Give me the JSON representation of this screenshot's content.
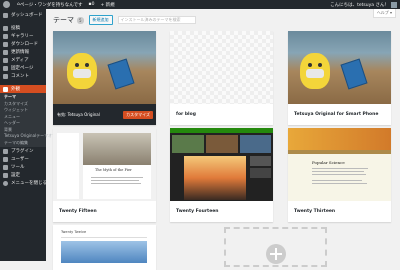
{
  "adminbar": {
    "site_name": "ページ・ワンダを持ちなんです",
    "comments": "0",
    "new_label": "+ 新規",
    "greeting": "こんにちは、tetsuya さん！"
  },
  "sidebar": {
    "items": [
      {
        "label": "ダッシュボード",
        "icon": "dashboard-icon"
      },
      {
        "label": "投稿",
        "icon": "pin-icon"
      },
      {
        "label": "ギャラリー",
        "icon": "gallery-icon"
      },
      {
        "label": "ダウンロード",
        "icon": "download-icon"
      },
      {
        "label": "更新情報",
        "icon": "news-icon"
      },
      {
        "label": "メディア",
        "icon": "media-icon"
      },
      {
        "label": "固定ページ",
        "icon": "page-icon"
      },
      {
        "label": "コメント",
        "icon": "comment-icon"
      },
      {
        "label": "外観",
        "icon": "appearance-icon"
      },
      {
        "label": "プラグイン",
        "icon": "plugin-icon"
      },
      {
        "label": "ユーザー",
        "icon": "user-icon"
      },
      {
        "label": "ツール",
        "icon": "tool-icon"
      },
      {
        "label": "設定",
        "icon": "settings-icon"
      },
      {
        "label": "メニューを閉じる",
        "icon": "collapse-icon"
      }
    ],
    "submenu": [
      "テーマ",
      "カスタマイズ",
      "ウィジェット",
      "メニュー",
      "ヘッダー",
      "背景",
      "Tetsuya Originalテーマオプション",
      "テーマの編集"
    ]
  },
  "header": {
    "title": "テーマ",
    "count": "5",
    "add_new": "新規追加",
    "search_placeholder": "インストール済みのテーマを検索",
    "help": "ヘルプ"
  },
  "themes": [
    {
      "name": "Tetsuya Original",
      "active_prefix": "有効:",
      "customize": "カスタマイズ"
    },
    {
      "name": "for blog"
    },
    {
      "name": "Tetsuya Original for Smart Phone"
    },
    {
      "name": "Twenty Fifteen"
    },
    {
      "name": "Twenty Fourteen"
    },
    {
      "name": "Twenty Thirteen"
    },
    {
      "name": "Twenty Twelve"
    }
  ],
  "fifteen_post_title": "The Myth of the Pier",
  "thirteen_post_title": "Popular Science",
  "colors": {
    "admin_bar": "#23282d",
    "accent": "#d54e21",
    "link": "#0073aa"
  }
}
